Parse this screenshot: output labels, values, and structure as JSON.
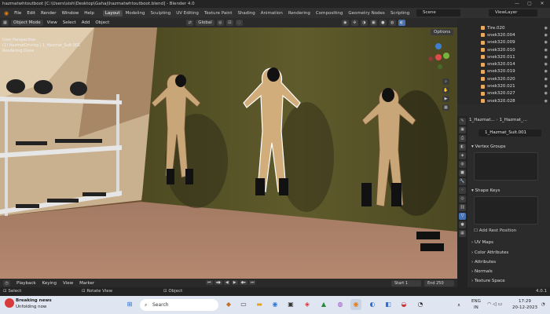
{
  "window": {
    "title": "hazmatwhtoutboot [C:\\Users\\sish\\Desktop\\Gahaj\\hazmatwhtoutboot.blend] - Blender 4.0",
    "controls": [
      "—",
      "▢",
      "✕"
    ]
  },
  "menubar": {
    "menus": [
      "File",
      "Edit",
      "Render",
      "Window",
      "Help"
    ],
    "workspaces": [
      "Layout",
      "Modeling",
      "Sculpting",
      "UV Editing",
      "Texture Paint",
      "Shading",
      "Animation",
      "Rendering",
      "Compositing",
      "Geometry Nodes",
      "Scripting"
    ],
    "active_workspace": "Layout",
    "scene": "Scene",
    "view_layer": "ViewLayer"
  },
  "viewport_header": {
    "mode": "Object Mode",
    "menus": [
      "View",
      "Select",
      "Add",
      "Object"
    ],
    "orientation": "Global",
    "options": "Options"
  },
  "viewport_info": {
    "view": "User Perspective",
    "object": "(1) HazmatDriving | 1_Hazmat_Suit.001",
    "status": "Rendering Done"
  },
  "outliner": {
    "items": [
      "Tire.020",
      "snek320.004",
      "snek320.009",
      "snek320.010",
      "snek320.011",
      "snek320.014",
      "snek320.019",
      "snek320.020",
      "snek320.021",
      "snek320.027",
      "snek320.028"
    ]
  },
  "properties": {
    "breadcrumb_object": "1_Hazmat...",
    "breadcrumb_mesh": "1_Hazmat_...",
    "mesh_name": "1_Hazmat_Suit.001",
    "sections": [
      "Vertex Groups",
      "Shape Keys",
      "UV Maps",
      "Color Attributes",
      "Attributes",
      "Normals",
      "Texture Space"
    ],
    "add_rest_position": "Add Rest Position"
  },
  "timeline": {
    "menus": [
      "Playback",
      "Keying",
      "View",
      "Marker"
    ],
    "start_label": "Start",
    "start_value": "1",
    "end_label": "End",
    "end_value": "250"
  },
  "statusbar": {
    "left": "Select",
    "middle": "Rotate View",
    "right": "Object",
    "version": "4.0.1"
  },
  "taskbar": {
    "news_title": "Breaking news",
    "news_sub": "Unfolding now",
    "search": "Search",
    "lang": "ENG",
    "region": "IN",
    "time": "17:29",
    "date": "20-12-2023"
  }
}
